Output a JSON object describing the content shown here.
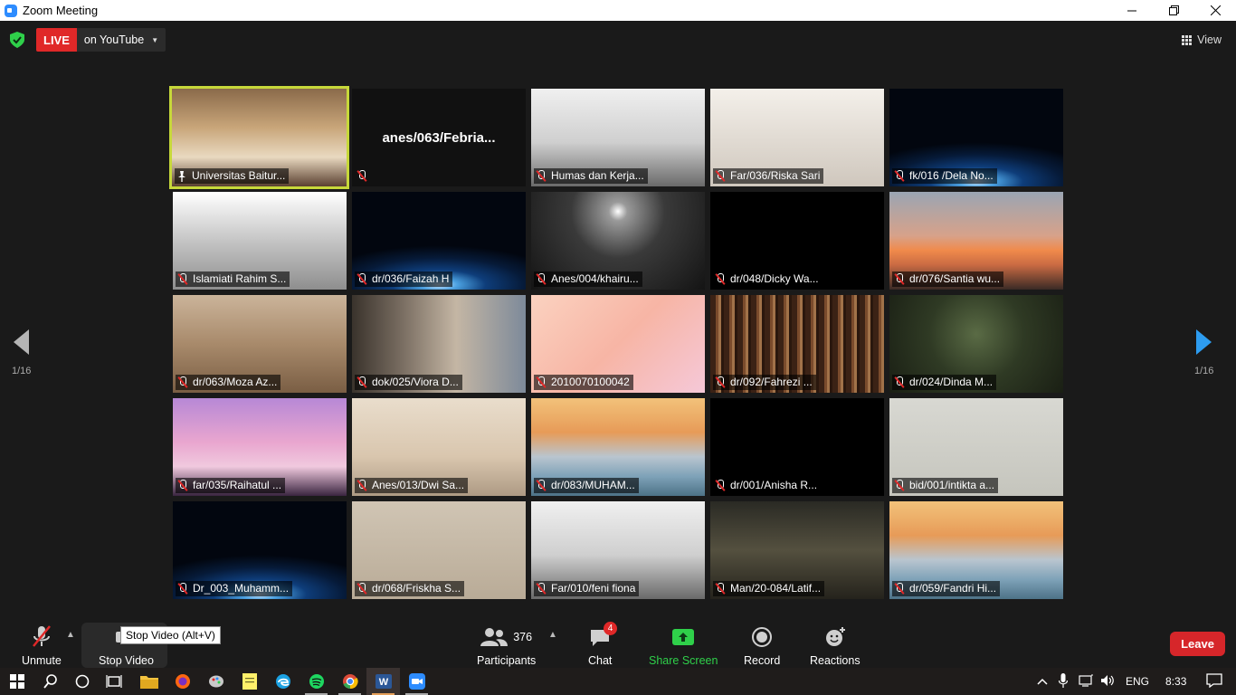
{
  "window": {
    "title": "Zoom Meeting"
  },
  "top_bar": {
    "live_label": "LIVE",
    "live_destination": "on YouTube",
    "view_label": "View"
  },
  "pagination": {
    "left": "1/16",
    "right": "1/16"
  },
  "tiles": [
    {
      "name": "Universitas Baitur...",
      "bg": "stage",
      "active": true,
      "pinned": true
    },
    {
      "name": "",
      "bg": "dark",
      "center": "anes/063/Febria..."
    },
    {
      "name": "Humas dan Kerja...",
      "bg": "office"
    },
    {
      "name": "Far/036/Riska Sari",
      "bg": "hijab"
    },
    {
      "name": "fk/016 /Dela No...",
      "bg": "earth"
    },
    {
      "name": "Islamiati Rahim S...",
      "bg": "cat"
    },
    {
      "name": "dr/036/Faizah H",
      "bg": "earth"
    },
    {
      "name": "Anes/004/khairu...",
      "bg": "ceiling"
    },
    {
      "name": "dr/048/Dicky Wa...",
      "bg": "black"
    },
    {
      "name": "dr/076/Santia wu...",
      "bg": "sunset"
    },
    {
      "name": "dr/063/Moza Az...",
      "bg": "bedroom"
    },
    {
      "name": "dok/025/Viora D...",
      "bg": "shelf"
    },
    {
      "name": "2010070100042",
      "bg": "pink"
    },
    {
      "name": "dr/092/Fahrezi ...",
      "bg": "library"
    },
    {
      "name": "dr/024/Dinda M...",
      "bg": "plant"
    },
    {
      "name": "far/035/Raihatul ...",
      "bg": "lilac"
    },
    {
      "name": "Anes/013/Dwi Sa...",
      "bg": "beige"
    },
    {
      "name": "dr/083/MUHAM...",
      "bg": "bridge"
    },
    {
      "name": "dr/001/Anisha R...",
      "bg": "black"
    },
    {
      "name": "bid/001/intikta a...",
      "bg": "grey"
    },
    {
      "name": "Dr_003_Muhamm...",
      "bg": "earth"
    },
    {
      "name": "dr/068/Friskha S...",
      "bg": "room2"
    },
    {
      "name": "Far/010/feni fiona",
      "bg": "office"
    },
    {
      "name": "Man/20-084/Latif...",
      "bg": "lamp"
    },
    {
      "name": "dr/059/Fandri Hi...",
      "bg": "bridge"
    }
  ],
  "toolbar": {
    "unmute": "Unmute",
    "stop_video": "Stop Video",
    "tooltip": "Stop Video (Alt+V)",
    "participants": "Participants",
    "participant_count": "376",
    "chat": "Chat",
    "chat_badge": "4",
    "share_screen": "Share Screen",
    "record": "Record",
    "reactions": "Reactions",
    "leave": "Leave"
  },
  "taskbar": {
    "language": "ENG",
    "time": "8:33"
  },
  "colors": {
    "live": "#e02828",
    "share": "#2fd04a",
    "leave": "#d6262a",
    "active_speaker": "#c7d83a",
    "next_arrow": "#2d9cf0"
  }
}
